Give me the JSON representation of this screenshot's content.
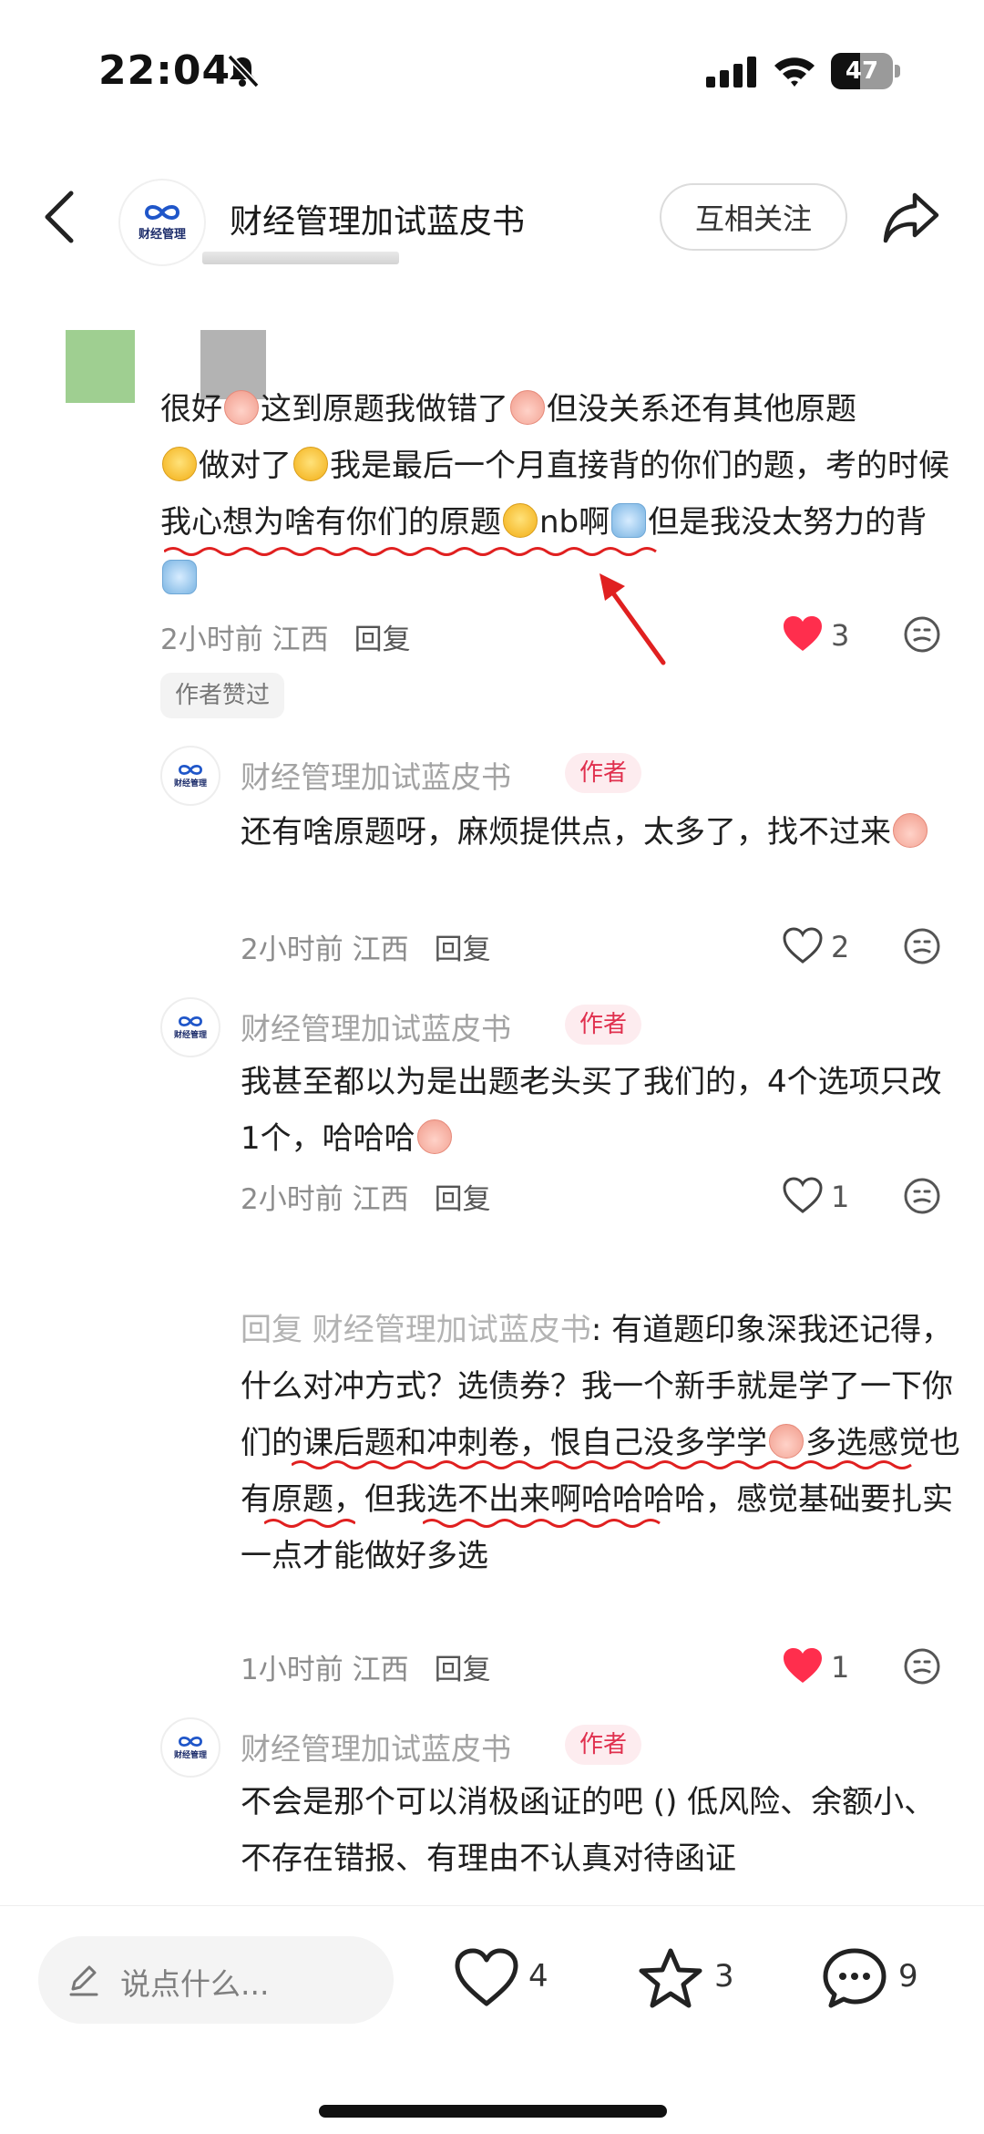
{
  "status_bar": {
    "time": "22:04",
    "battery": "47",
    "icons": [
      "bell-muted-icon",
      "cellular-signal-icon",
      "wifi-icon",
      "battery-icon"
    ]
  },
  "header": {
    "title": "财经管理加试蓝皮书",
    "avatar_text": "财经管理",
    "follow_label": "互相关注"
  },
  "top_comment": {
    "text_parts": [
      "很好",
      "这到原题我做错了",
      "但没关系还有其他原题",
      "做对了",
      "我是最后一个月直接背的你们的题，考的时候我心想为啥有你们的原题",
      "nb啊",
      "但是我没太努力的背"
    ],
    "time": "2小时前",
    "location": "江西",
    "reply_label": "回复",
    "likes": "3",
    "liked": true,
    "author_liked_label": "作者赞过"
  },
  "replies": [
    {
      "name": "财经管理加试蓝皮书",
      "badge": "作者",
      "text": "还有啥原题呀，麻烦提供点，太多了，找不过来",
      "time": "2小时前",
      "location": "江西",
      "reply_label": "回复",
      "likes": "2",
      "liked": false
    },
    {
      "name": "财经管理加试蓝皮书",
      "badge": "作者",
      "text": "我甚至都以为是出题老头买了我们的，4个选项只改1个，哈哈哈",
      "time": "2小时前",
      "location": "江西",
      "reply_label": "回复",
      "likes": "1",
      "liked": false
    },
    {
      "ref_prefix": "回复 财经管理加试蓝皮书",
      "text_a": ": 有道题印象深我还记得，什么对冲方式？选债券？我一个新手就是学了一下你们的课后题和冲刺卷，恨自己没多学学",
      "text_b": "多选感觉也有原题，但我选不出来啊哈哈哈哈，感觉基础要扎实一点才能做好多选",
      "time": "1小时前",
      "location": "江西",
      "reply_label": "回复",
      "likes": "1",
      "liked": true
    },
    {
      "name": "财经管理加试蓝皮书",
      "badge": "作者",
      "text": "不会是那个可以消极函证的吧 () 低风险、余额小、不存在错报、有理由不认真对待函证"
    }
  ],
  "bottom_bar": {
    "input_placeholder": "说点什么...",
    "likes": "4",
    "stars": "3",
    "comments": "9"
  },
  "colors": {
    "like_red": "#ff2e4d",
    "badge_bg": "#fdecef",
    "badge_text": "#e0304e",
    "underline_red": "#e02020"
  }
}
